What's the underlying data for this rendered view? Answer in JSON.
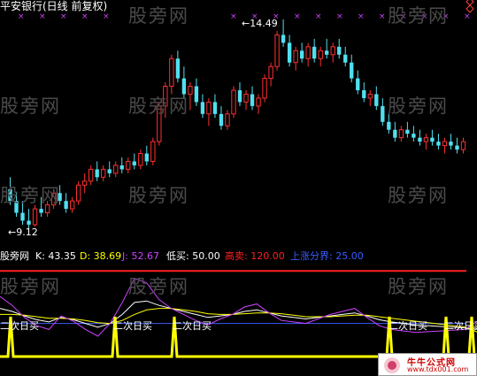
{
  "main_panel": {
    "title": "平安银行(日线 前复权)",
    "high_label": "14.49",
    "low_label": "9.12",
    "title_color": "#ffffff"
  },
  "indicator_panel": {
    "name": "股旁网",
    "k_label": "K: 43.35",
    "d_label": "D: 38.69",
    "j_label": "J: 52.67",
    "buy_low_label": "低买: 50.00",
    "sell_high_label": "高卖: 120.00",
    "rise_label": "上涨分界: 25.00",
    "signal_text": "二次日买",
    "colors": {
      "k": "#ffffff",
      "d": "#ffff00",
      "j": "#cc44ff",
      "buy": "#ffffff",
      "sell": "#ff2020",
      "rise": "#3a5cff",
      "signal": "#ffff00"
    }
  },
  "watermark": "股旁网",
  "site_logo": {
    "name": "牛牛公式网",
    "url": "www.tdx001.com"
  },
  "colors": {
    "up": "#ff3030",
    "down": "#50e0f0",
    "bg": "#000000"
  },
  "chart_data": [
    {
      "type": "candlestick",
      "title": "平安银行(日线 前复权)",
      "annotations": {
        "max": 14.49,
        "min": 9.12
      },
      "ohlc": [
        [
          10.2,
          10.5,
          9.8,
          9.9
        ],
        [
          9.9,
          10.1,
          9.5,
          9.6
        ],
        [
          9.6,
          9.9,
          9.3,
          9.4
        ],
        [
          9.4,
          9.7,
          9.12,
          9.3
        ],
        [
          9.3,
          9.8,
          9.25,
          9.7
        ],
        [
          9.7,
          10.0,
          9.5,
          9.6
        ],
        [
          9.6,
          9.9,
          9.5,
          9.8
        ],
        [
          9.8,
          10.2,
          9.7,
          10.1
        ],
        [
          10.1,
          10.3,
          9.8,
          9.9
        ],
        [
          9.9,
          10.1,
          9.6,
          9.7
        ],
        [
          9.7,
          10.0,
          9.6,
          9.9
        ],
        [
          9.9,
          10.4,
          9.8,
          10.3
        ],
        [
          10.3,
          10.6,
          10.1,
          10.4
        ],
        [
          10.4,
          10.8,
          10.3,
          10.7
        ],
        [
          10.7,
          10.9,
          10.4,
          10.5
        ],
        [
          10.5,
          10.8,
          10.4,
          10.7
        ],
        [
          10.7,
          10.9,
          10.5,
          10.6
        ],
        [
          10.6,
          10.9,
          10.5,
          10.8
        ],
        [
          10.8,
          11.0,
          10.6,
          10.7
        ],
        [
          10.7,
          11.0,
          10.6,
          10.9
        ],
        [
          10.9,
          11.1,
          10.7,
          10.8
        ],
        [
          10.8,
          11.2,
          10.7,
          11.1
        ],
        [
          11.1,
          11.3,
          10.8,
          10.9
        ],
        [
          10.9,
          11.5,
          10.8,
          11.4
        ],
        [
          11.4,
          12.4,
          11.3,
          12.3
        ],
        [
          12.3,
          12.9,
          12.0,
          12.8
        ],
        [
          12.8,
          13.6,
          12.6,
          13.5
        ],
        [
          13.5,
          13.7,
          12.9,
          13.0
        ],
        [
          13.0,
          13.3,
          12.5,
          12.6
        ],
        [
          12.6,
          12.9,
          12.2,
          12.8
        ],
        [
          12.8,
          13.0,
          12.3,
          12.4
        ],
        [
          12.4,
          12.6,
          12.0,
          12.1
        ],
        [
          12.1,
          12.5,
          11.8,
          12.4
        ],
        [
          12.4,
          12.6,
          12.0,
          12.1
        ],
        [
          12.1,
          12.3,
          11.7,
          11.8
        ],
        [
          11.8,
          12.2,
          11.7,
          12.1
        ],
        [
          12.1,
          12.8,
          12.0,
          12.7
        ],
        [
          12.7,
          12.9,
          12.3,
          12.4
        ],
        [
          12.4,
          12.7,
          12.2,
          12.6
        ],
        [
          12.6,
          12.8,
          12.2,
          12.3
        ],
        [
          12.3,
          12.6,
          12.1,
          12.5
        ],
        [
          12.5,
          13.1,
          12.4,
          13.0
        ],
        [
          13.0,
          13.4,
          12.8,
          13.3
        ],
        [
          13.3,
          14.2,
          13.2,
          14.1
        ],
        [
          14.1,
          14.49,
          13.8,
          13.9
        ],
        [
          13.9,
          14.1,
          13.3,
          13.4
        ],
        [
          13.4,
          13.8,
          13.2,
          13.7
        ],
        [
          13.7,
          13.9,
          13.4,
          13.5
        ],
        [
          13.5,
          13.9,
          13.3,
          13.8
        ],
        [
          13.8,
          14.0,
          13.4,
          13.5
        ],
        [
          13.5,
          13.8,
          13.3,
          13.7
        ],
        [
          13.7,
          14.0,
          13.5,
          13.6
        ],
        [
          13.6,
          13.9,
          13.4,
          13.8
        ],
        [
          13.8,
          14.0,
          13.5,
          13.6
        ],
        [
          13.6,
          13.8,
          13.3,
          13.4
        ],
        [
          13.4,
          13.6,
          12.9,
          13.0
        ],
        [
          13.0,
          13.2,
          12.6,
          12.7
        ],
        [
          12.7,
          12.9,
          12.4,
          12.5
        ],
        [
          12.5,
          12.7,
          12.3,
          12.6
        ],
        [
          12.6,
          12.8,
          12.2,
          12.3
        ],
        [
          12.3,
          12.5,
          11.8,
          11.9
        ],
        [
          11.9,
          12.1,
          11.6,
          11.7
        ],
        [
          11.7,
          11.9,
          11.4,
          11.5
        ],
        [
          11.5,
          11.8,
          11.4,
          11.7
        ],
        [
          11.7,
          11.9,
          11.5,
          11.6
        ],
        [
          11.6,
          11.8,
          11.4,
          11.5
        ],
        [
          11.5,
          11.7,
          11.3,
          11.4
        ],
        [
          11.4,
          11.6,
          11.2,
          11.5
        ],
        [
          11.5,
          11.7,
          11.3,
          11.4
        ],
        [
          11.4,
          11.6,
          11.2,
          11.3
        ],
        [
          11.3,
          11.5,
          11.1,
          11.4
        ],
        [
          11.4,
          11.6,
          11.2,
          11.3
        ],
        [
          11.3,
          11.5,
          11.1,
          11.2
        ],
        [
          11.2,
          11.5,
          11.1,
          11.4
        ]
      ]
    },
    {
      "type": "line",
      "title": "股旁网",
      "series": [
        {
          "name": "K",
          "values": [
            70,
            66,
            60,
            55,
            52,
            58,
            55,
            50,
            45,
            50,
            62,
            78,
            80,
            74,
            70,
            66,
            62,
            58,
            60,
            62,
            66,
            68,
            64,
            60,
            58,
            56,
            58,
            60,
            62,
            64,
            60,
            55,
            52,
            50,
            48,
            47,
            46,
            45,
            44,
            43.35
          ]
        },
        {
          "name": "D",
          "values": [
            62,
            62,
            61,
            59,
            57,
            57,
            56,
            54,
            51,
            50,
            54,
            62,
            68,
            70,
            70,
            68,
            66,
            63,
            62,
            62,
            63,
            64,
            64,
            63,
            61,
            59,
            59,
            59,
            60,
            61,
            61,
            59,
            57,
            55,
            53,
            51,
            49,
            47,
            45,
            38.69
          ]
        },
        {
          "name": "J",
          "values": [
            86,
            74,
            58,
            47,
            42,
            60,
            53,
            42,
            33,
            50,
            78,
            110,
            104,
            82,
            70,
            62,
            54,
            48,
            56,
            62,
            72,
            76,
            64,
            54,
            52,
            50,
            56,
            62,
            66,
            70,
            58,
            47,
            42,
            40,
            38,
            39,
            40,
            41,
            42,
            52.67
          ]
        }
      ],
      "reference_lines": {
        "低买": 50.0,
        "高卖": 120.0,
        "上涨分界": 25.0
      }
    }
  ]
}
